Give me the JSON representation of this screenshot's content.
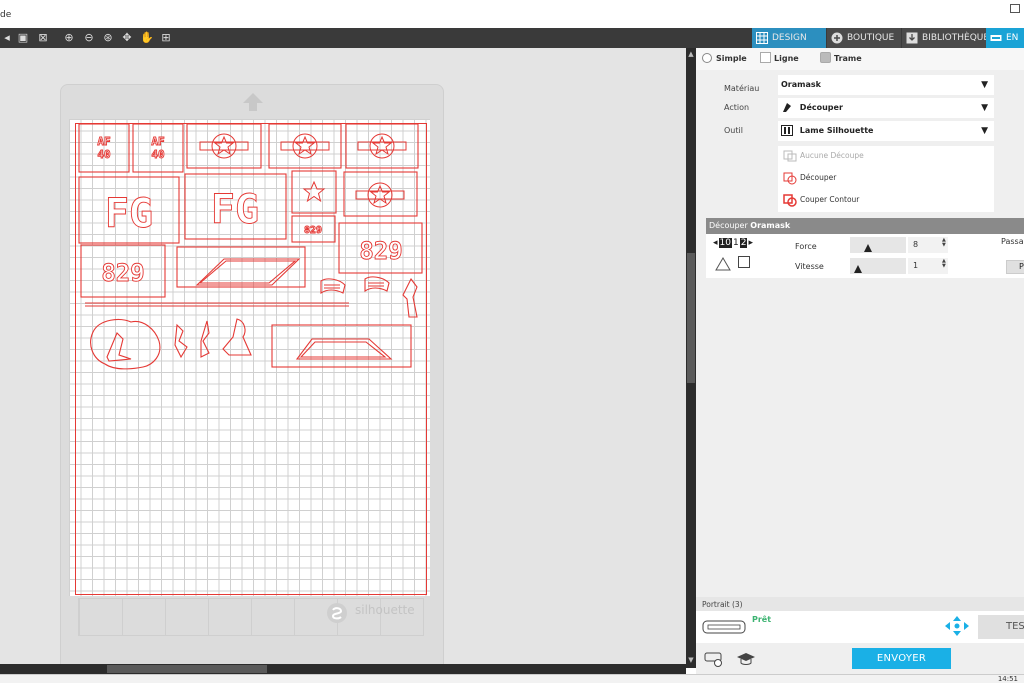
{
  "window": {
    "title_fragment": "de"
  },
  "tabs": [
    {
      "label": "DESIGN"
    },
    {
      "label": "BOUTIQUE"
    },
    {
      "label": "BIBLIOTHÈQUE"
    },
    {
      "label": "EN"
    }
  ],
  "canvas": {
    "watermark": "silhouette",
    "labels": {
      "af1": "AF",
      "af1b": "40",
      "af2": "AF",
      "af2b": "40",
      "fg1": "FG",
      "fg2": "FG",
      "n829a": "829",
      "n829b": "829",
      "n829c": "829"
    }
  },
  "panel": {
    "modes": [
      "Simple",
      "Ligne",
      "Trame"
    ],
    "properties": {
      "materiau": {
        "label": "Matériau",
        "value": "Oramask"
      },
      "action": {
        "label": "Action",
        "value": "Découper"
      },
      "outil": {
        "label": "Outil",
        "value": "Lame Silhouette"
      }
    },
    "cut_options": [
      "Aucune Découpe",
      "Découper",
      "Couper Contour"
    ],
    "cut_settings": {
      "header_prefix": "Découper",
      "header_material": "Oramask",
      "blade_values": [
        "10",
        "1",
        "2"
      ],
      "force_label": "Force",
      "force_value": "8",
      "force_level": 0.25,
      "vitesse_label": "Vitesse",
      "vitesse_value": "1",
      "vitesse_level": 0.05,
      "passages_label": "Passages",
      "passages_btn": "P"
    },
    "status": {
      "device_label": "Portrait (3)",
      "state": "Prêt",
      "test_label": "TES",
      "send_label": "ENVOYER"
    }
  },
  "taskbar": {
    "clock": "14:51"
  },
  "colors": {
    "accent": "#1ab0e6",
    "cut": "#e53935",
    "ready": "#3cb371"
  }
}
